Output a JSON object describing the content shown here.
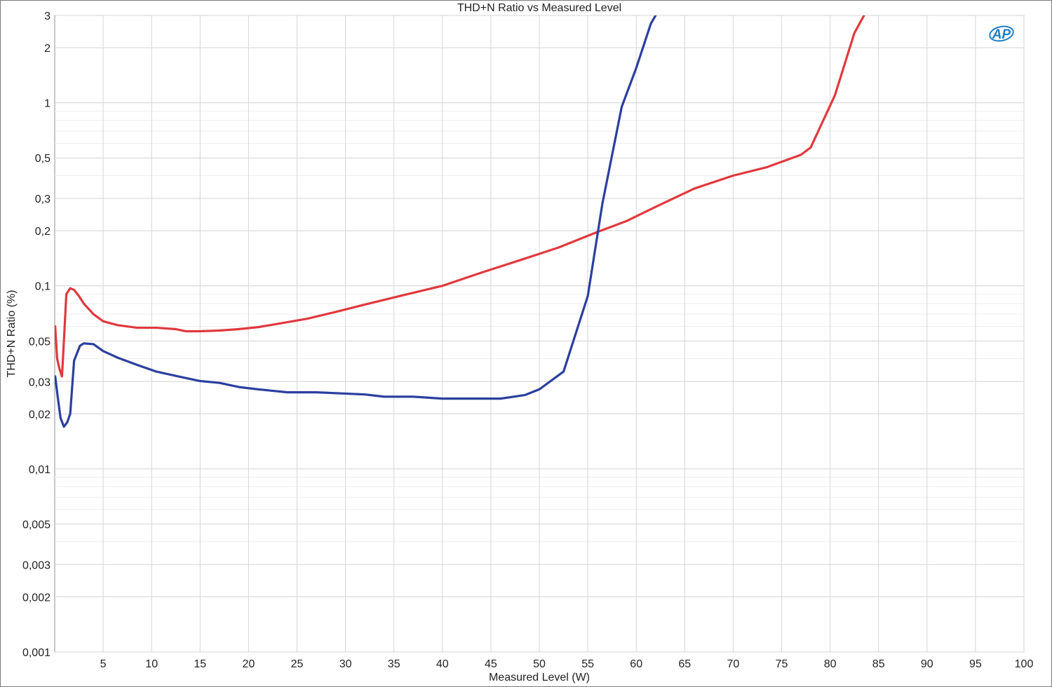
{
  "chart_data": {
    "type": "line",
    "title": "THD+N Ratio vs Measured Level",
    "xlabel": "Measured Level (W)",
    "ylabel": "THD+N Ratio (%)",
    "xlim": [
      0,
      100
    ],
    "ylim": [
      0.001,
      3
    ],
    "yscale": "log",
    "grid": true,
    "x_ticks": [
      5,
      10,
      15,
      20,
      25,
      30,
      35,
      40,
      45,
      50,
      55,
      60,
      65,
      70,
      75,
      80,
      85,
      90,
      95,
      100
    ],
    "x_tick_labels": [
      "5",
      "10",
      "15",
      "20",
      "25",
      "30",
      "35",
      "40",
      "45",
      "50",
      "55",
      "60",
      "65",
      "70",
      "75",
      "80",
      "85",
      "90",
      "95",
      "100"
    ],
    "y_ticks": [
      0.001,
      0.002,
      0.003,
      0.005,
      0.01,
      0.02,
      0.03,
      0.05,
      0.1,
      0.2,
      0.3,
      0.5,
      1,
      2,
      3
    ],
    "y_tick_labels": [
      "0,001",
      "0,002",
      "0,003",
      "0,005",
      "0,01",
      "0,02",
      "0,03",
      "0,05",
      "0,1",
      "0,2",
      "0,3",
      "0,5",
      "1",
      "2",
      "3"
    ],
    "series": [
      {
        "color": "#e0393e",
        "points": [
          [
            0.05,
            0.06
          ],
          [
            0.25,
            0.04
          ],
          [
            0.5,
            0.035
          ],
          [
            0.75,
            0.032
          ],
          [
            0.95,
            0.05
          ],
          [
            1.2,
            0.09
          ],
          [
            1.6,
            0.097
          ],
          [
            2.0,
            0.095
          ],
          [
            2.5,
            0.088
          ],
          [
            3.0,
            0.08
          ],
          [
            4.0,
            0.07
          ],
          [
            5.0,
            0.064
          ],
          [
            6.5,
            0.061
          ],
          [
            8.5,
            0.059
          ],
          [
            10.5,
            0.059
          ],
          [
            12.5,
            0.058
          ],
          [
            13.5,
            0.0565
          ],
          [
            15,
            0.0565
          ],
          [
            17,
            0.057
          ],
          [
            19,
            0.058
          ],
          [
            21,
            0.0595
          ],
          [
            23,
            0.062
          ],
          [
            26,
            0.066
          ],
          [
            29,
            0.072
          ],
          [
            32,
            0.079
          ],
          [
            36,
            0.089
          ],
          [
            40,
            0.1
          ],
          [
            44,
            0.118
          ],
          [
            48,
            0.138
          ],
          [
            52,
            0.162
          ],
          [
            56,
            0.197
          ],
          [
            59,
            0.226
          ],
          [
            62,
            0.27
          ],
          [
            66,
            0.34
          ],
          [
            70,
            0.4
          ],
          [
            73.5,
            0.445
          ],
          [
            77,
            0.52
          ],
          [
            78,
            0.57
          ],
          [
            80.5,
            1.1
          ],
          [
            82.5,
            2.4
          ],
          [
            83.5,
            3.0
          ]
        ]
      },
      {
        "color": "#2b3f9e",
        "points": [
          [
            0.05,
            0.032
          ],
          [
            0.3,
            0.025
          ],
          [
            0.6,
            0.019
          ],
          [
            0.95,
            0.017
          ],
          [
            1.3,
            0.018
          ],
          [
            1.6,
            0.02
          ],
          [
            2.0,
            0.039
          ],
          [
            2.6,
            0.047
          ],
          [
            3.0,
            0.0485
          ],
          [
            4.0,
            0.048
          ],
          [
            5.0,
            0.044
          ],
          [
            6.5,
            0.0405
          ],
          [
            8.5,
            0.037
          ],
          [
            10.5,
            0.034
          ],
          [
            13,
            0.0318
          ],
          [
            15,
            0.0302
          ],
          [
            17,
            0.0295
          ],
          [
            19,
            0.028
          ],
          [
            21,
            0.0272
          ],
          [
            24,
            0.0262
          ],
          [
            27,
            0.0262
          ],
          [
            32,
            0.0255
          ],
          [
            34,
            0.0248
          ],
          [
            37,
            0.0248
          ],
          [
            40,
            0.0242
          ],
          [
            43,
            0.0242
          ],
          [
            46,
            0.0242
          ],
          [
            48.5,
            0.0253
          ],
          [
            50,
            0.0272
          ],
          [
            52.5,
            0.034
          ],
          [
            55,
            0.088
          ],
          [
            56.5,
            0.28
          ],
          [
            58.5,
            0.95
          ],
          [
            60,
            1.55
          ],
          [
            61.5,
            2.7
          ],
          [
            62,
            3.0
          ]
        ]
      }
    ]
  },
  "logo": {
    "text": "AP",
    "color": "#1f7fc4"
  }
}
